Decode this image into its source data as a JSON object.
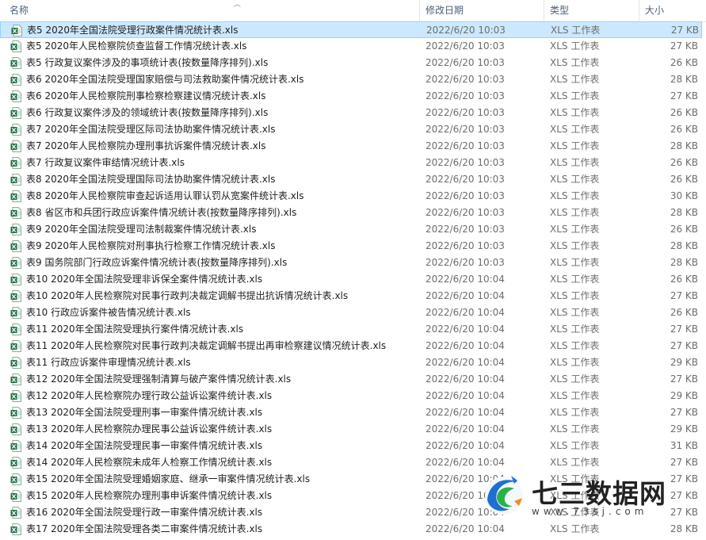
{
  "columns": {
    "name": "名称",
    "modified": "修改日期",
    "type": "类型",
    "size": "大小"
  },
  "files": [
    {
      "name": "表5 2020年全国法院受理行政案件情况统计表.xls",
      "modified": "2022/6/20 10:03",
      "type": "XLS 工作表",
      "size": "27 KB",
      "selected": true
    },
    {
      "name": "表5 2020年人民检察院侦查监督工作情况统计表.xls",
      "modified": "2022/6/20 10:03",
      "type": "XLS 工作表",
      "size": "27 KB"
    },
    {
      "name": "表5 行政复议案件涉及的事项统计表(按数量降序排列).xls",
      "modified": "2022/6/20 10:03",
      "type": "XLS 工作表",
      "size": "26 KB"
    },
    {
      "name": "表6 2020年全国法院受理国家赔偿与司法救助案件情况统计表.xls",
      "modified": "2022/6/20 10:03",
      "type": "XLS 工作表",
      "size": "28 KB"
    },
    {
      "name": "表6 2020年人民检察院刑事检察检察建议情况统计表.xls",
      "modified": "2022/6/20 10:03",
      "type": "XLS 工作表",
      "size": "27 KB"
    },
    {
      "name": "表6 行政复议案件涉及的领域统计表(按数量降序排列).xls",
      "modified": "2022/6/20 10:03",
      "type": "XLS 工作表",
      "size": "26 KB"
    },
    {
      "name": "表7 2020年全国法院受理区际司法协助案件情况统计表.xls",
      "modified": "2022/6/20 10:03",
      "type": "XLS 工作表",
      "size": "26 KB"
    },
    {
      "name": "表7 2020年人民检察院办理刑事抗诉案件情况统计表.xls",
      "modified": "2022/6/20 10:03",
      "type": "XLS 工作表",
      "size": "28 KB"
    },
    {
      "name": "表7 行政复议案件审结情况统计表.xls",
      "modified": "2022/6/20 10:03",
      "type": "XLS 工作表",
      "size": "26 KB"
    },
    {
      "name": "表8 2020年全国法院受理国际司法协助案件情况统计表.xls",
      "modified": "2022/6/20 10:03",
      "type": "XLS 工作表",
      "size": "26 KB"
    },
    {
      "name": "表8 2020年人民检察院审查起诉适用认罪认罚从宽案件统计表.xls",
      "modified": "2022/6/20 10:03",
      "type": "XLS 工作表",
      "size": "30 KB"
    },
    {
      "name": "表8 省区市和兵团行政应诉案件情况统计表(按数量降序排列).xls",
      "modified": "2022/6/20 10:03",
      "type": "XLS 工作表",
      "size": "28 KB"
    },
    {
      "name": "表9 2020年全国法院受理司法制裁案件情况统计表.xls",
      "modified": "2022/6/20 10:03",
      "type": "XLS 工作表",
      "size": "26 KB"
    },
    {
      "name": "表9 2020年人民检察院对刑事执行检察工作情况统计表.xls",
      "modified": "2022/6/20 10:03",
      "type": "XLS 工作表",
      "size": "28 KB"
    },
    {
      "name": "表9 国务院部门行政应诉案件情况统计表(按数量降序排列).xls",
      "modified": "2022/6/20 10:03",
      "type": "XLS 工作表",
      "size": "28 KB"
    },
    {
      "name": "表10 2020年全国法院受理非诉保全案件情况统计表.xls",
      "modified": "2022/6/20 10:04",
      "type": "XLS 工作表",
      "size": "26 KB"
    },
    {
      "name": "表10 2020年人民检察院对民事行政判决裁定调解书提出抗诉情况统计表.xls",
      "modified": "2022/6/20 10:04",
      "type": "XLS 工作表",
      "size": "27 KB"
    },
    {
      "name": "表10 行政应诉案件被告情况统计表.xls",
      "modified": "2022/6/20 10:04",
      "type": "XLS 工作表",
      "size": "26 KB"
    },
    {
      "name": "表11 2020年全国法院受理执行案件情况统计表.xls",
      "modified": "2022/6/20 10:04",
      "type": "XLS 工作表",
      "size": "27 KB"
    },
    {
      "name": "表11 2020年人民检察院对民事行政判决裁定调解书提出再审检察建议情况统计表.xls",
      "modified": "2022/6/20 10:04",
      "type": "XLS 工作表",
      "size": "27 KB"
    },
    {
      "name": "表11 行政应诉案件审理情况统计表.xls",
      "modified": "2022/6/20 10:04",
      "type": "XLS 工作表",
      "size": "29 KB"
    },
    {
      "name": "表12 2020年全国法院受理强制清算与破产案件情况统计表.xls",
      "modified": "2022/6/20 10:04",
      "type": "XLS 工作表",
      "size": "27 KB"
    },
    {
      "name": "表12 2020年人民检察院办理行政公益诉讼案件统计表.xls",
      "modified": "2022/6/20 10:04",
      "type": "XLS 工作表",
      "size": "29 KB"
    },
    {
      "name": "表13 2020年全国法院受理刑事一审案件情况统计表.xls",
      "modified": "2022/6/20 10:04",
      "type": "XLS 工作表",
      "size": "27 KB"
    },
    {
      "name": "表13 2020年人民检察院办理民事公益诉讼案件统计表.xls",
      "modified": "2022/6/20 10:04",
      "type": "XLS 工作表",
      "size": "29 KB"
    },
    {
      "name": "表14 2020年全国法院受理民事一审案件情况统计表.xls",
      "modified": "2022/6/20 10:04",
      "type": "XLS 工作表",
      "size": "31 KB"
    },
    {
      "name": "表14 2020年人民检察院未成年人检察工作情况统计表.xls",
      "modified": "2022/6/20 10:04",
      "type": "XLS 工作表",
      "size": "27 KB"
    },
    {
      "name": "表15 2020年全国法院受理婚姻家庭、继承一审案件情况统计表.xls",
      "modified": "2022/6/20 10:04",
      "type": "XLS 工作表",
      "size": "27 KB"
    },
    {
      "name": "表15 2020年人民检察院办理刑事申诉案件情况统计表.xls",
      "modified": "2022/6/20 10:04",
      "type": "XLS 工作表",
      "size": "27 KB"
    },
    {
      "name": "表16 2020年全国法院受理行政一审案件情况统计表.xls",
      "modified": "2022/6/20 10:04",
      "type": "XLS 工作表",
      "size": "27 KB"
    },
    {
      "name": "表17 2020年全国法院受理各类二审案件情况统计表.xls",
      "modified": "2022/6/20 10:04",
      "type": "XLS 工作表",
      "size": "28 KB"
    }
  ],
  "watermark": {
    "title": "七三数据网",
    "url": "www.73sj.com"
  },
  "colors": {
    "selection_bg": "#cce8ff",
    "selection_border": "#99d1ff",
    "excel_green": "#1d7044",
    "header_text": "#4c607a"
  },
  "icons": {
    "file": "excel-file-icon",
    "sort": "sort-caret-icon",
    "logo": "logo-icon"
  }
}
